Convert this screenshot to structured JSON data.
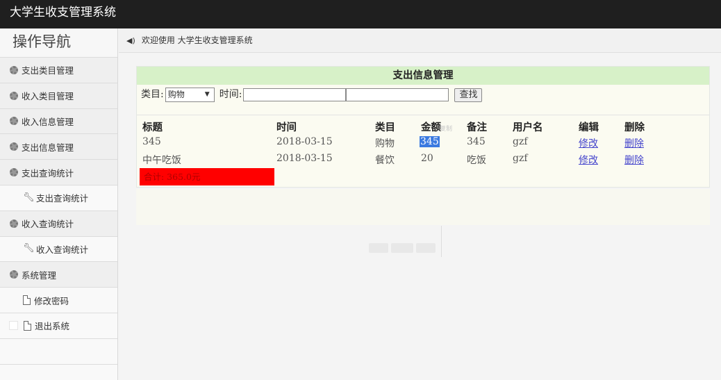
{
  "app": {
    "title": "大学生收支管理系统"
  },
  "sidebar": {
    "title": "操作导航",
    "items": [
      {
        "label": "支出类目管理",
        "icon": "gear-icon"
      },
      {
        "label": "收入类目管理",
        "icon": "gear-icon"
      },
      {
        "label": "收入信息管理",
        "icon": "gear-icon"
      },
      {
        "label": "支出信息管理",
        "icon": "gear-icon"
      },
      {
        "label": "支出查询统计",
        "icon": "gear-icon"
      },
      {
        "label": "支出查询统计",
        "icon": "wrench-icon"
      },
      {
        "label": "收入查询统计",
        "icon": "gear-icon"
      },
      {
        "label": "收入查询统计",
        "icon": "wrench-icon"
      },
      {
        "label": "系统管理",
        "icon": "gear-icon"
      },
      {
        "label": "修改密码",
        "icon": "file-icon"
      },
      {
        "label": "退出系统",
        "icon": "file-icon"
      }
    ]
  },
  "header": {
    "welcome": "欢迎使用 大学生收支管理系统",
    "icon": "speaker-icon"
  },
  "panel": {
    "title": "支出信息管理",
    "filter": {
      "category_label": "类目:",
      "category_value": "购物",
      "time_label": "时间:",
      "search_button": "查找"
    },
    "table": {
      "headers": [
        "标题",
        "时间",
        "类目",
        "金额",
        "备注",
        "用户名",
        "编辑",
        "删除"
      ],
      "rows": [
        [
          "345",
          "2018-03-15",
          "购物",
          "345",
          "345",
          "gzf",
          "修改",
          "删除"
        ],
        [
          "中午吃饭",
          "2018-03-15",
          "餐饮",
          "20",
          "吃饭",
          "gzf",
          "修改",
          "删除"
        ]
      ]
    },
    "total": "合计: 365.0元",
    "ghost_tag": "复制"
  }
}
